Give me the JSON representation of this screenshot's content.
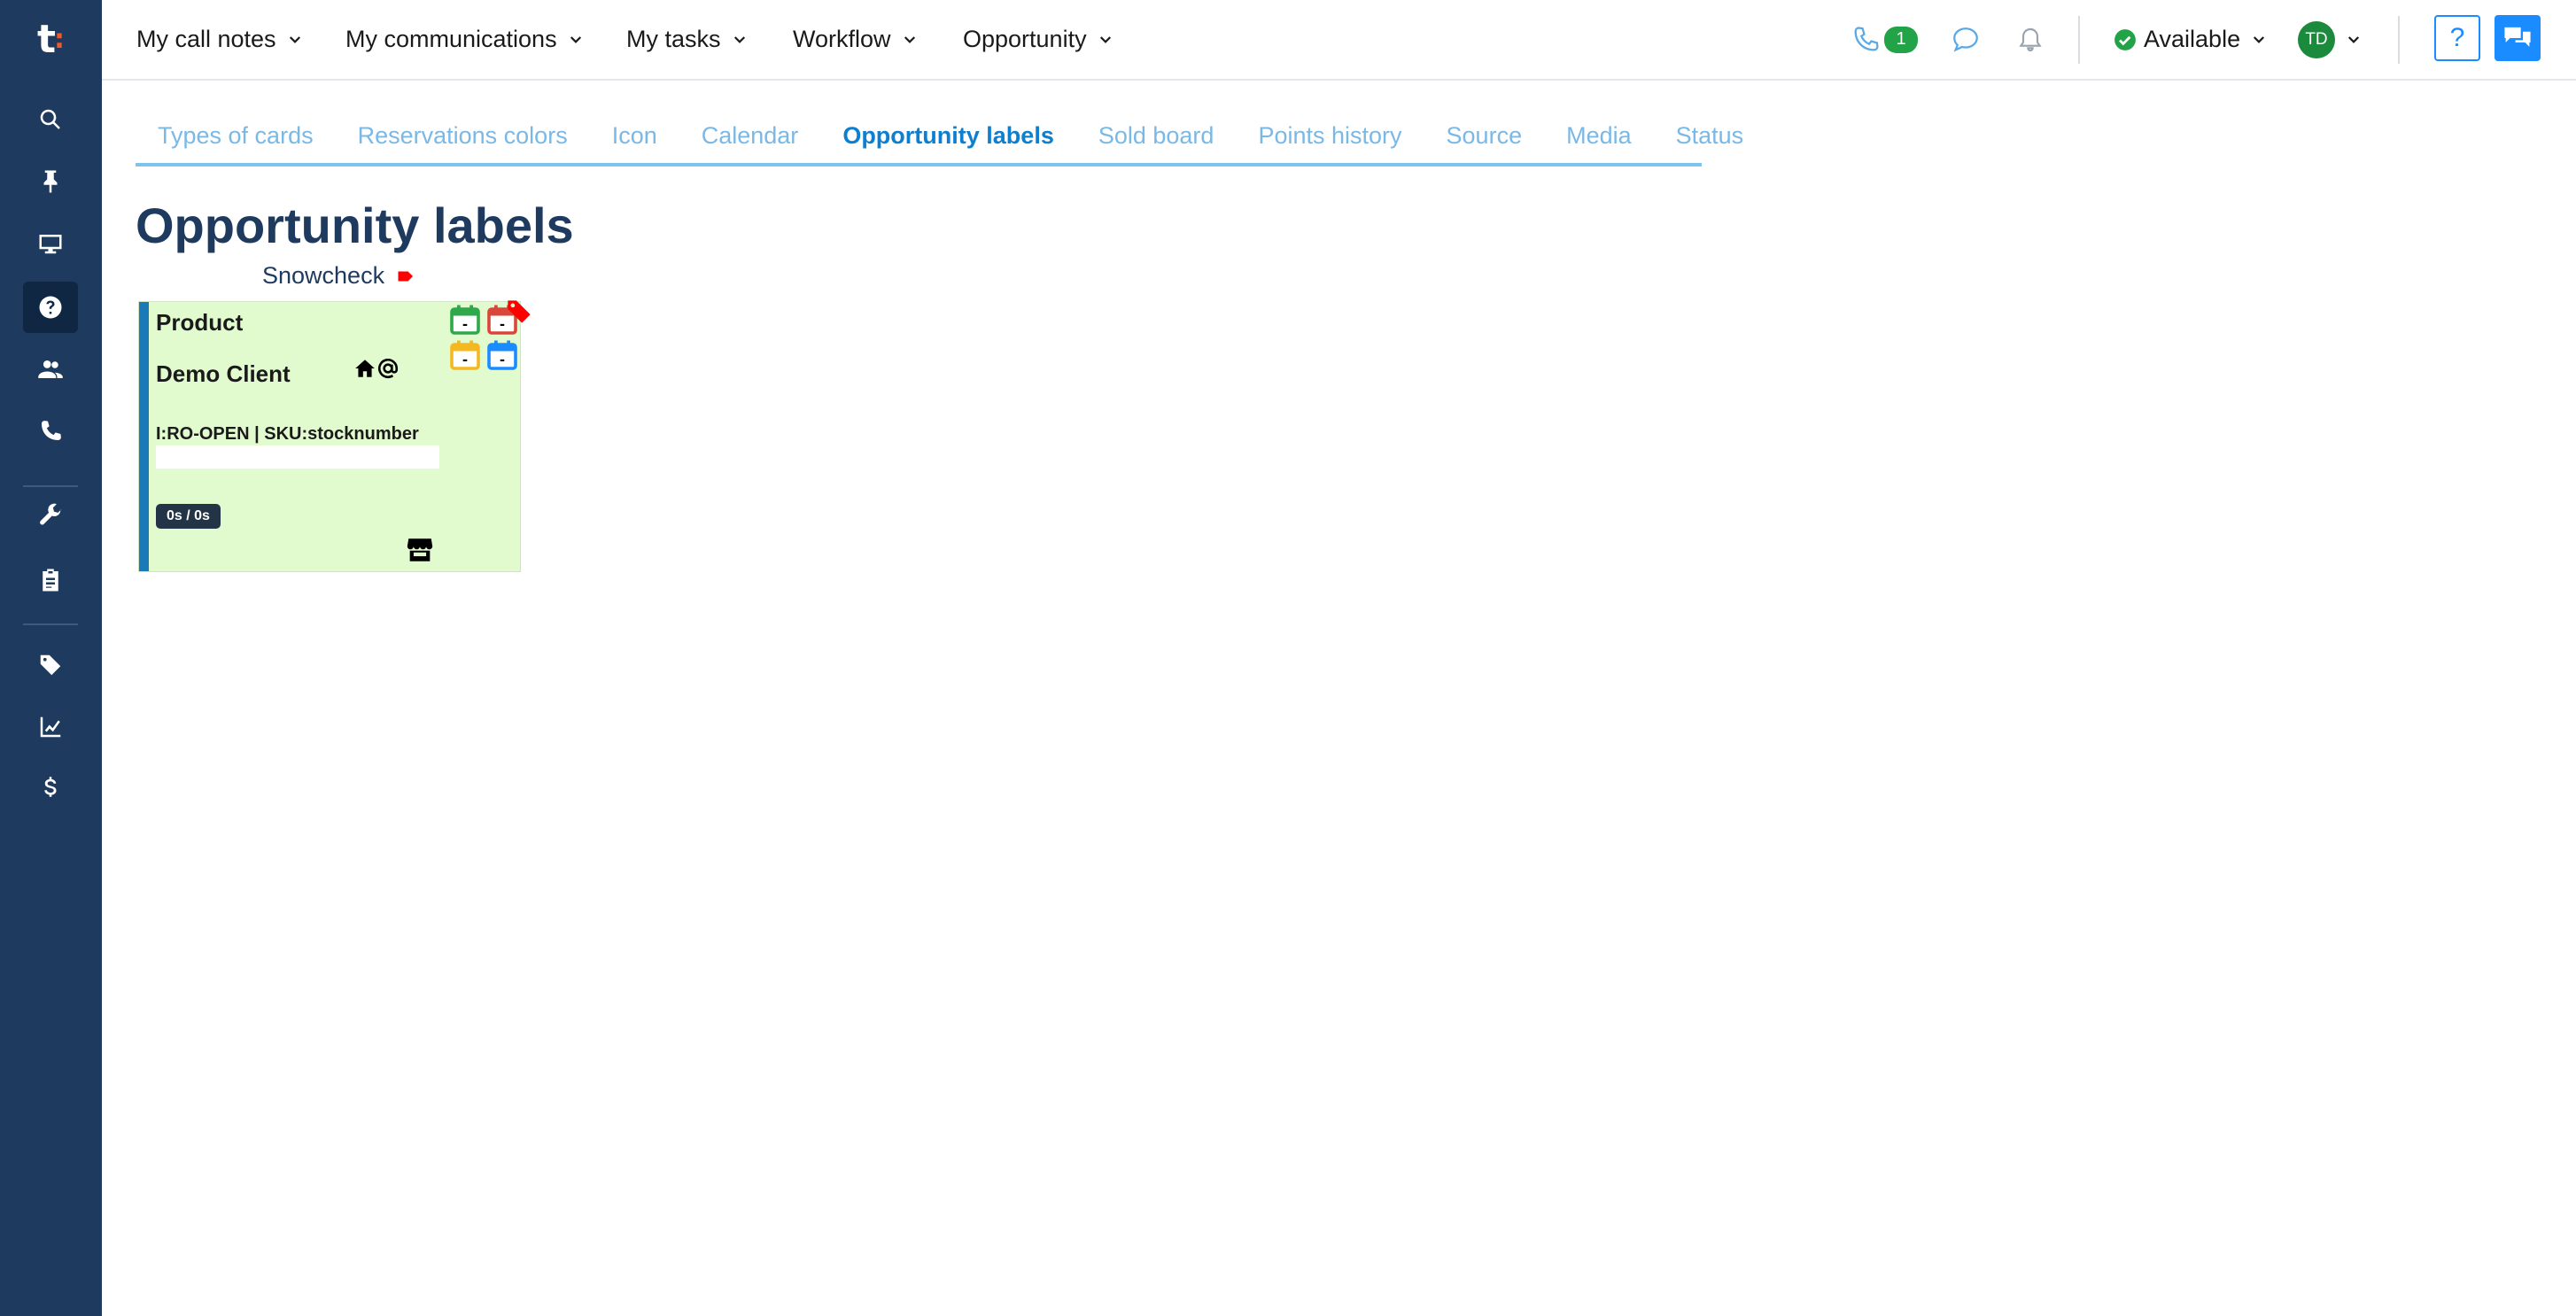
{
  "logo": {
    "text": "t",
    "dot": ":"
  },
  "sidebar": {
    "items": [
      {
        "icon": "search-icon"
      },
      {
        "icon": "pin-icon"
      },
      {
        "icon": "desktop-icon"
      },
      {
        "icon": "help-circle-icon",
        "active": true
      },
      {
        "icon": "users-icon"
      },
      {
        "icon": "phone-icon"
      },
      {
        "icon": "wrench-icon"
      },
      {
        "icon": "clipboard-icon"
      },
      {
        "icon": "tag-icon"
      },
      {
        "icon": "chart-line-icon"
      },
      {
        "icon": "dollar-icon"
      }
    ]
  },
  "topnav": {
    "menus": [
      "My call notes",
      "My communications",
      "My tasks",
      "Workflow",
      "Opportunity"
    ],
    "phone_count": "1",
    "status": "Available",
    "avatar_initials": "TD",
    "help_label": "?"
  },
  "tabs": [
    {
      "label": "Types of cards"
    },
    {
      "label": "Reservations colors"
    },
    {
      "label": "Icon"
    },
    {
      "label": "Calendar"
    },
    {
      "label": "Opportunity labels",
      "active": true
    },
    {
      "label": "Sold board"
    },
    {
      "label": "Points history"
    },
    {
      "label": "Source"
    },
    {
      "label": "Media"
    },
    {
      "label": "Status"
    }
  ],
  "page": {
    "title": "Opportunity labels"
  },
  "card": {
    "label_name": "Snowcheck",
    "product": "Product",
    "client": "Demo Client",
    "sku_line": "I:RO-OPEN | SKU:stocknumber",
    "time": "0s / 0s",
    "calendar_value": "-"
  },
  "colors": {
    "sidebar": "#1e3a5f",
    "accent": "#1a8cff",
    "card_bg": "#e1fbcf",
    "label_red": "#ff0000",
    "cal_green": "#2ea84a",
    "cal_red": "#d9473b",
    "cal_yellow": "#f5b820",
    "cal_blue": "#1a8cff"
  }
}
